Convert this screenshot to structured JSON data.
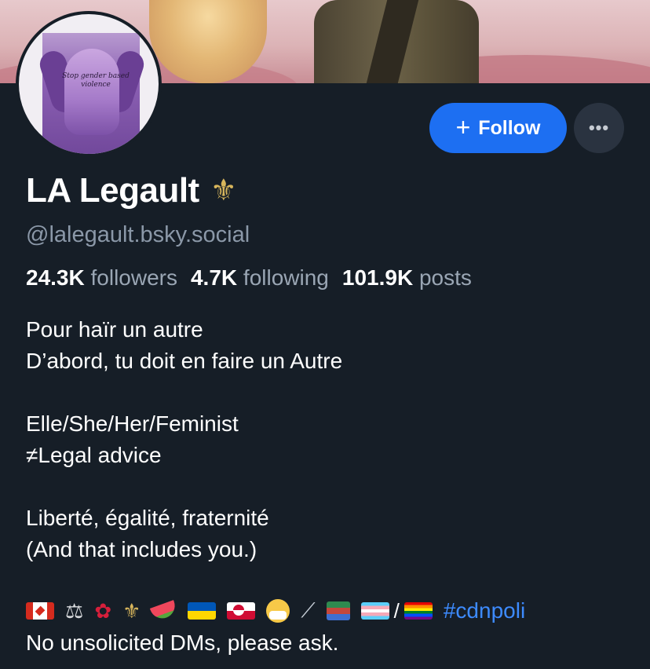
{
  "profile": {
    "display_name": "LA Legault",
    "name_emoji": "⚜",
    "handle": "@lalegault.bsky.social",
    "avatar_caption": "Stop gender based violence"
  },
  "actions": {
    "follow_label": "Follow",
    "follow_icon": "plus-icon",
    "more_label": "•••"
  },
  "stats": {
    "followers_count": "24.3K",
    "followers_label": "followers",
    "following_count": "4.7K",
    "following_label": "following",
    "posts_count": "101.9K",
    "posts_label": "posts"
  },
  "bio": {
    "line1": "Pour haïr un autre",
    "line2": "D’abord, tu doit en faire un Autre",
    "line3": "Elle/She/Her/Feminist",
    "line4": "≠Legal advice",
    "line5": "Liberté, égalité, fraternité",
    "line6": "(And that includes you.)",
    "hashtag": "#cdnpoli",
    "last_line": "No unsolicited DMs,  please ask."
  },
  "emojis": [
    "canada-flag",
    "scales",
    "rose",
    "fleur-de-lis",
    "watermelon",
    "ukraine-flag",
    "greenland-flag",
    "mask-face",
    "syringe",
    "books",
    "trans-flag",
    "pride-flag"
  ],
  "colors": {
    "background": "#161e27",
    "accent_blue": "#1d6ff2",
    "muted_text": "#8b98a8",
    "link": "#3d8bff"
  }
}
